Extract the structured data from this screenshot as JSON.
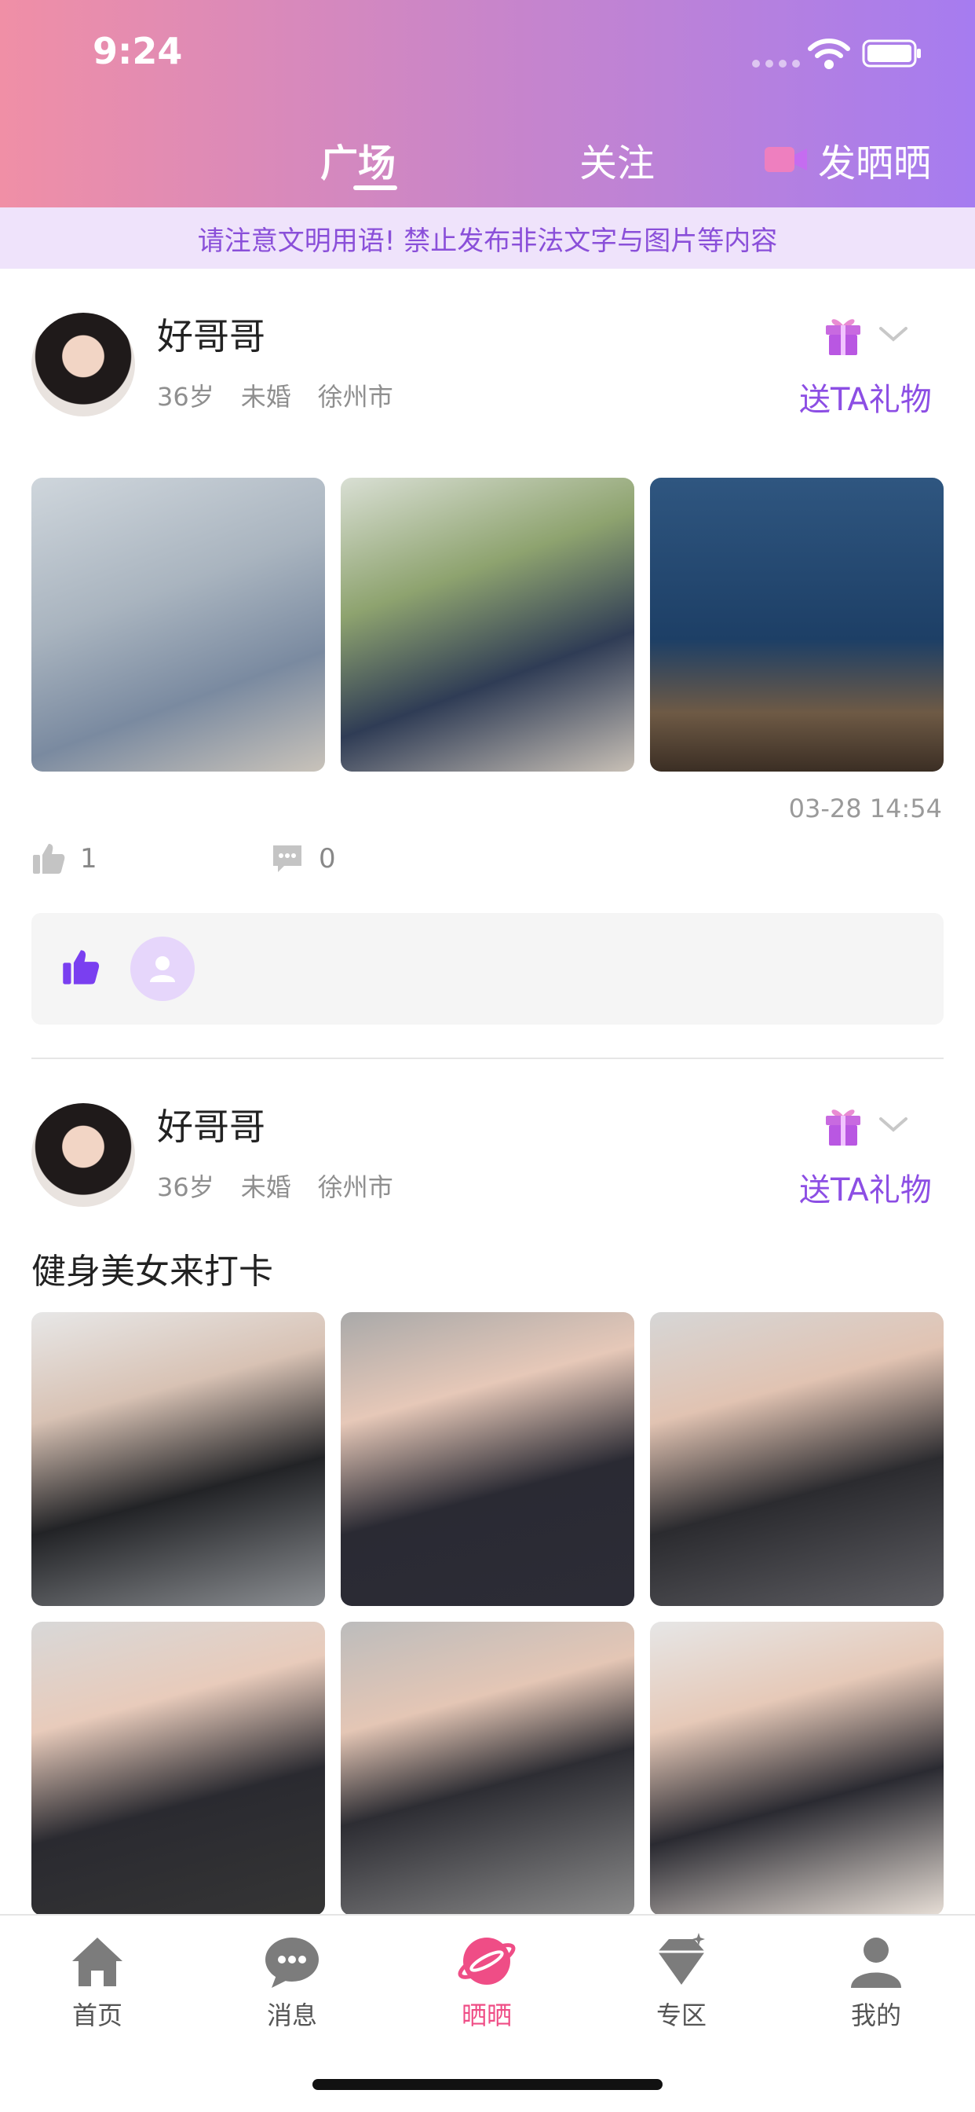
{
  "status_bar": {
    "time": "9:24"
  },
  "header": {
    "tabs": [
      {
        "label": "广场",
        "active": true
      },
      {
        "label": "关注",
        "active": false
      }
    ],
    "post_button_label": "发晒晒"
  },
  "notice": "请注意文明用语! 禁止发布非法文字与图片等内容",
  "posts": [
    {
      "username": "好哥哥",
      "age": "36岁",
      "marital": "未婚",
      "city": "徐州市",
      "gift_label": "送TA礼物",
      "caption": "",
      "photo_count": 3,
      "timestamp": "03-28 14:54",
      "likes": "1",
      "comments": "0"
    },
    {
      "username": "好哥哥",
      "age": "36岁",
      "marital": "未婚",
      "city": "徐州市",
      "gift_label": "送TA礼物",
      "caption": "健身美女来打卡",
      "photo_count": 6
    }
  ],
  "bottom_nav": [
    {
      "label": "首页",
      "icon": "home-icon"
    },
    {
      "label": "消息",
      "icon": "message-icon"
    },
    {
      "label": "晒晒",
      "icon": "planet-icon",
      "active": true
    },
    {
      "label": "专区",
      "icon": "diamond-icon"
    },
    {
      "label": "我的",
      "icon": "user-icon"
    }
  ],
  "colors": {
    "accent_purple": "#8c4ee4",
    "active_pink": "#ef4d86",
    "header_start": "#f08fa6",
    "header_end": "#a67cf0"
  }
}
